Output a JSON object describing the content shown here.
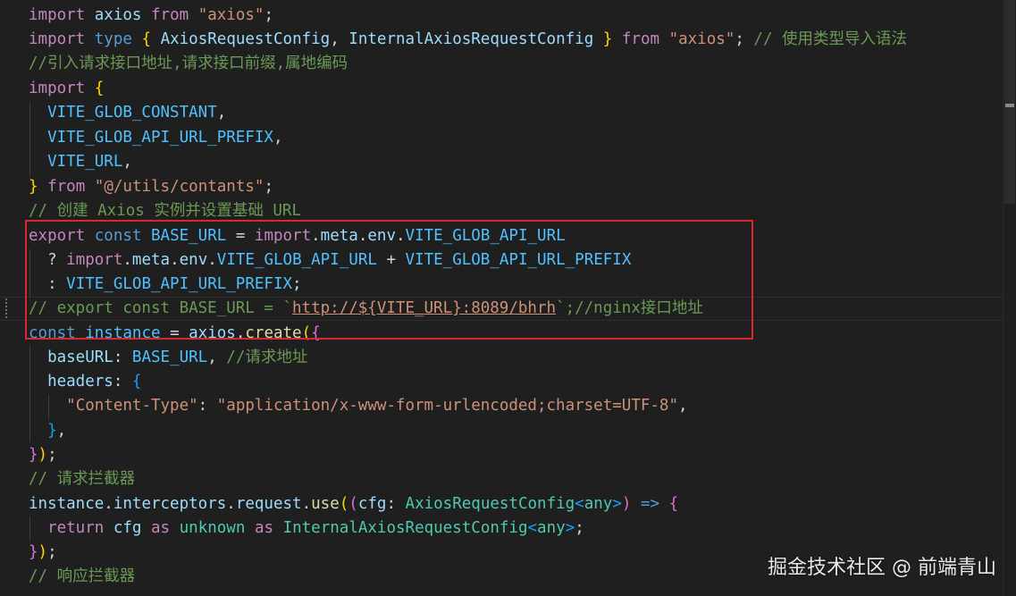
{
  "editor": {
    "theme_colors": {
      "background": "#1f1f1f",
      "keyword_control": "#c586c0",
      "keyword": "#569cd6",
      "string": "#ce9178",
      "comment": "#6a9955",
      "variable": "#9cdcfe",
      "constant": "#4fc1ff",
      "function": "#dcdcaa",
      "type": "#4ec9b0",
      "highlight_box": "#d9262f"
    },
    "lines": [
      [
        "import",
        " ",
        "axios",
        " ",
        "from",
        " ",
        "\"axios\"",
        ";"
      ],
      [
        "import",
        " ",
        "type",
        " ",
        "{",
        " ",
        "AxiosRequestConfig",
        ", ",
        "InternalAxiosRequestConfig",
        " ",
        "}",
        " ",
        "from",
        " ",
        "\"axios\"",
        "; ",
        "// 使用类型导入语法"
      ],
      [
        "//引入请求接口地址,请求接口前缀,属地编码"
      ],
      [
        "import",
        " ",
        "{"
      ],
      [
        "  ",
        "VITE_GLOB_CONSTANT",
        ","
      ],
      [
        "  ",
        "VITE_GLOB_API_URL_PREFIX",
        ","
      ],
      [
        "  ",
        "VITE_URL",
        ","
      ],
      [
        "}",
        " ",
        "from",
        " ",
        "\"@/utils/contants\"",
        ";"
      ],
      [
        "// 创建 Axios 实例并设置基础 URL"
      ],
      [
        "export",
        " ",
        "const",
        " ",
        "BASE_URL",
        " = ",
        "import",
        ".",
        "meta",
        ".",
        "env",
        ".",
        "VITE_GLOB_API_URL"
      ],
      [
        "  ? ",
        "import",
        ".",
        "meta",
        ".",
        "env",
        ".",
        "VITE_GLOB_API_URL",
        " + ",
        "VITE_GLOB_API_URL_PREFIX"
      ],
      [
        "  : ",
        "VITE_GLOB_API_URL_PREFIX",
        ";"
      ],
      [
        "// export const BASE_URL = `",
        "http://${VITE_URL}:8089/bhrh",
        "`;//nginx接口地址"
      ],
      [
        "const",
        " ",
        "instance",
        " = ",
        "axios",
        ".",
        "create",
        "(",
        "{"
      ],
      [
        "  ",
        "baseURL",
        ": ",
        "BASE_URL",
        ", ",
        "//请求地址"
      ],
      [
        "  ",
        "headers",
        ": ",
        "{"
      ],
      [
        "    ",
        "\"Content-Type\"",
        ": ",
        "\"application/x-www-form-urlencoded;charset=UTF-8\"",
        ","
      ],
      [
        "  ",
        "}",
        ","
      ],
      [
        "}",
        ")",
        ";"
      ],
      [
        "// 请求拦截器"
      ],
      [
        "instance",
        ".",
        "interceptors",
        ".",
        "request",
        ".",
        "use",
        "(",
        "(",
        "cfg",
        ": ",
        "AxiosRequestConfig",
        "<",
        "any",
        ">",
        ")",
        " => ",
        "{"
      ],
      [
        "  ",
        "return",
        " ",
        "cfg",
        " ",
        "as",
        " ",
        "unknown",
        " ",
        "as",
        " ",
        "InternalAxiosRequestConfig",
        "<",
        "any",
        ">",
        ";"
      ],
      [
        "}",
        ")",
        ";"
      ],
      [
        "// 响应拦截器"
      ]
    ]
  },
  "watermark": {
    "text": "掘金技术社区 @ 前端青山"
  }
}
